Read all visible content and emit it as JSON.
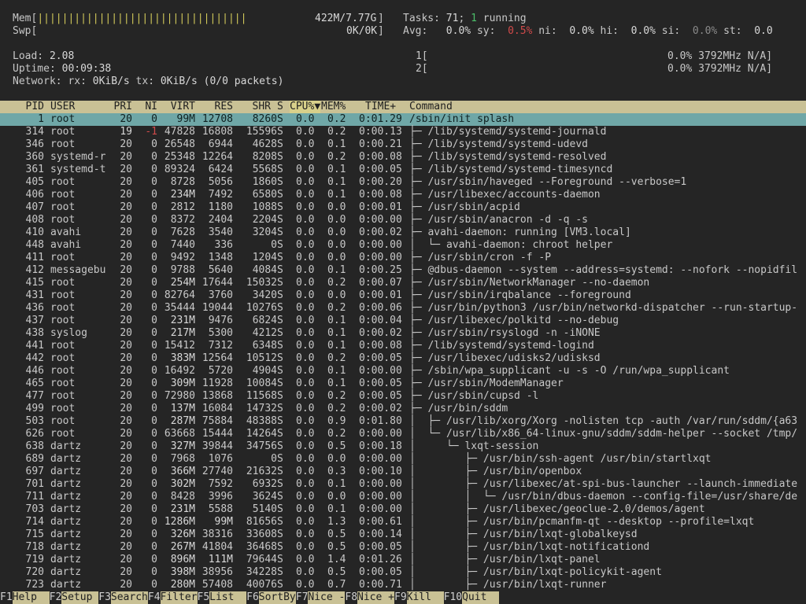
{
  "meters": {
    "mem": {
      "label": "Mem",
      "bar": "||||||||||||||||||||||||||||||||||",
      "value": "422M/7.77G"
    },
    "swp": {
      "label": "Swp",
      "bar": "",
      "value": "0K/0K"
    },
    "load": {
      "label": "Load:",
      "value": "2.08"
    },
    "uptime": {
      "label": "Uptime:",
      "value": "00:09:38"
    },
    "network": {
      "label": "Network: rx:",
      "rx": "0KiB/s",
      "tx_label": "tx:",
      "tx": "0KiB/s",
      "packets": "(0/0 packets)"
    },
    "tasks": {
      "label": "Tasks:",
      "count": "71",
      "running": "1",
      "running_label": "running"
    },
    "avg": {
      "label": "Avg:",
      "us": "0.0%",
      "sy_label": "sy:",
      "sy": "0.5%",
      "ni_label": "ni:",
      "ni": "0.0%",
      "hi_label": "hi:",
      "hi": "0.0%",
      "si_label": "si:",
      "si": "0.0%",
      "st_label": "st:",
      "st": "0.0"
    },
    "cpu1": {
      "label": "1[",
      "value": "0.0% 3792MHz N/A]"
    },
    "cpu2": {
      "label": "2[",
      "value": "0.0% 3792MHz N/A]"
    }
  },
  "columns": {
    "pid": "PID",
    "user": "USER",
    "pri": "PRI",
    "ni": "NI",
    "virt": "VIRT",
    "res": "RES",
    "shr": "SHR",
    "s": "S",
    "cpu": "CPU%",
    "sort_arrow": "▼",
    "mem": "MEM%",
    "time": "TIME+",
    "command": "Command"
  },
  "processes": [
    {
      "pid": "1",
      "user": "root",
      "pri": "20",
      "ni": "0",
      "virt": "99M",
      "res": "12708",
      "shr": "8260",
      "s": "S",
      "cpu": "0.0",
      "mem": "0.2",
      "time": "0:01.29",
      "tree": "",
      "command": "/sbin/init splash"
    },
    {
      "pid": "314",
      "user": "root",
      "pri": "19",
      "ni": "-1",
      "virt": "47828",
      "res": "16808",
      "shr": "15596",
      "s": "S",
      "cpu": "0.0",
      "mem": "0.2",
      "time": "0:00.13",
      "tree": "├─ ",
      "command": "/lib/systemd/systemd-journald"
    },
    {
      "pid": "346",
      "user": "root",
      "pri": "20",
      "ni": "0",
      "virt": "26548",
      "res": "6944",
      "shr": "4628",
      "s": "S",
      "cpu": "0.0",
      "mem": "0.1",
      "time": "0:00.21",
      "tree": "├─ ",
      "command": "/lib/systemd/systemd-udevd"
    },
    {
      "pid": "360",
      "user": "systemd-r",
      "pri": "20",
      "ni": "0",
      "virt": "25348",
      "res": "12264",
      "shr": "8208",
      "s": "S",
      "cpu": "0.0",
      "mem": "0.2",
      "time": "0:00.08",
      "tree": "├─ ",
      "command": "/lib/systemd/systemd-resolved"
    },
    {
      "pid": "361",
      "user": "systemd-t",
      "pri": "20",
      "ni": "0",
      "virt": "89324",
      "res": "6424",
      "shr": "5568",
      "s": "S",
      "cpu": "0.0",
      "mem": "0.1",
      "time": "0:00.05",
      "tree": "├─ ",
      "command": "/lib/systemd/systemd-timesyncd"
    },
    {
      "pid": "405",
      "user": "root",
      "pri": "20",
      "ni": "0",
      "virt": "8728",
      "res": "5056",
      "shr": "1860",
      "s": "S",
      "cpu": "0.0",
      "mem": "0.1",
      "time": "0:00.20",
      "tree": "├─ ",
      "command": "/usr/sbin/haveged --Foreground --verbose=1"
    },
    {
      "pid": "406",
      "user": "root",
      "pri": "20",
      "ni": "0",
      "virt": "234M",
      "res": "7492",
      "shr": "6580",
      "s": "S",
      "cpu": "0.0",
      "mem": "0.1",
      "time": "0:00.08",
      "tree": "├─ ",
      "command": "/usr/libexec/accounts-daemon"
    },
    {
      "pid": "407",
      "user": "root",
      "pri": "20",
      "ni": "0",
      "virt": "2812",
      "res": "1180",
      "shr": "1088",
      "s": "S",
      "cpu": "0.0",
      "mem": "0.0",
      "time": "0:00.01",
      "tree": "├─ ",
      "command": "/usr/sbin/acpid"
    },
    {
      "pid": "408",
      "user": "root",
      "pri": "20",
      "ni": "0",
      "virt": "8372",
      "res": "2404",
      "shr": "2204",
      "s": "S",
      "cpu": "0.0",
      "mem": "0.0",
      "time": "0:00.00",
      "tree": "├─ ",
      "command": "/usr/sbin/anacron -d -q -s"
    },
    {
      "pid": "410",
      "user": "avahi",
      "pri": "20",
      "ni": "0",
      "virt": "7628",
      "res": "3540",
      "shr": "3204",
      "s": "S",
      "cpu": "0.0",
      "mem": "0.0",
      "time": "0:00.02",
      "tree": "├─ ",
      "command": "avahi-daemon: running [VM3.local]"
    },
    {
      "pid": "448",
      "user": "avahi",
      "pri": "20",
      "ni": "0",
      "virt": "7440",
      "res": "336",
      "shr": "0",
      "s": "S",
      "cpu": "0.0",
      "mem": "0.0",
      "time": "0:00.00",
      "tree": "│  └─ ",
      "command": "avahi-daemon: chroot helper"
    },
    {
      "pid": "411",
      "user": "root",
      "pri": "20",
      "ni": "0",
      "virt": "9492",
      "res": "1348",
      "shr": "1204",
      "s": "S",
      "cpu": "0.0",
      "mem": "0.0",
      "time": "0:00.00",
      "tree": "├─ ",
      "command": "/usr/sbin/cron -f -P"
    },
    {
      "pid": "412",
      "user": "messagebu",
      "pri": "20",
      "ni": "0",
      "virt": "9788",
      "res": "5640",
      "shr": "4084",
      "s": "S",
      "cpu": "0.0",
      "mem": "0.1",
      "time": "0:00.25",
      "tree": "├─ ",
      "command": "@dbus-daemon --system --address=systemd: --nofork --nopidfil"
    },
    {
      "pid": "415",
      "user": "root",
      "pri": "20",
      "ni": "0",
      "virt": "254M",
      "res": "17644",
      "shr": "15032",
      "s": "S",
      "cpu": "0.0",
      "mem": "0.2",
      "time": "0:00.07",
      "tree": "├─ ",
      "command": "/usr/sbin/NetworkManager --no-daemon"
    },
    {
      "pid": "431",
      "user": "root",
      "pri": "20",
      "ni": "0",
      "virt": "82764",
      "res": "3760",
      "shr": "3420",
      "s": "S",
      "cpu": "0.0",
      "mem": "0.0",
      "time": "0:00.01",
      "tree": "├─ ",
      "command": "/usr/sbin/irqbalance --foreground"
    },
    {
      "pid": "436",
      "user": "root",
      "pri": "20",
      "ni": "0",
      "virt": "35444",
      "res": "19044",
      "shr": "10276",
      "s": "S",
      "cpu": "0.0",
      "mem": "0.2",
      "time": "0:00.06",
      "tree": "├─ ",
      "command": "/usr/bin/python3 /usr/bin/networkd-dispatcher --run-startup-"
    },
    {
      "pid": "437",
      "user": "root",
      "pri": "20",
      "ni": "0",
      "virt": "231M",
      "res": "9476",
      "shr": "6824",
      "s": "S",
      "cpu": "0.0",
      "mem": "0.1",
      "time": "0:00.04",
      "tree": "├─ ",
      "command": "/usr/libexec/polkitd --no-debug"
    },
    {
      "pid": "438",
      "user": "syslog",
      "pri": "20",
      "ni": "0",
      "virt": "217M",
      "res": "5300",
      "shr": "4212",
      "s": "S",
      "cpu": "0.0",
      "mem": "0.1",
      "time": "0:00.02",
      "tree": "├─ ",
      "command": "/usr/sbin/rsyslogd -n -iNONE"
    },
    {
      "pid": "441",
      "user": "root",
      "pri": "20",
      "ni": "0",
      "virt": "15412",
      "res": "7312",
      "shr": "6348",
      "s": "S",
      "cpu": "0.0",
      "mem": "0.1",
      "time": "0:00.08",
      "tree": "├─ ",
      "command": "/lib/systemd/systemd-logind"
    },
    {
      "pid": "442",
      "user": "root",
      "pri": "20",
      "ni": "0",
      "virt": "383M",
      "res": "12564",
      "shr": "10512",
      "s": "S",
      "cpu": "0.0",
      "mem": "0.2",
      "time": "0:00.05",
      "tree": "├─ ",
      "command": "/usr/libexec/udisks2/udisksd"
    },
    {
      "pid": "446",
      "user": "root",
      "pri": "20",
      "ni": "0",
      "virt": "16492",
      "res": "5720",
      "shr": "4904",
      "s": "S",
      "cpu": "0.0",
      "mem": "0.1",
      "time": "0:00.00",
      "tree": "├─ ",
      "command": "/sbin/wpa_supplicant -u -s -O /run/wpa_supplicant"
    },
    {
      "pid": "465",
      "user": "root",
      "pri": "20",
      "ni": "0",
      "virt": "309M",
      "res": "11928",
      "shr": "10084",
      "s": "S",
      "cpu": "0.0",
      "mem": "0.1",
      "time": "0:00.05",
      "tree": "├─ ",
      "command": "/usr/sbin/ModemManager"
    },
    {
      "pid": "477",
      "user": "root",
      "pri": "20",
      "ni": "0",
      "virt": "72980",
      "res": "13868",
      "shr": "11568",
      "s": "S",
      "cpu": "0.0",
      "mem": "0.2",
      "time": "0:00.05",
      "tree": "├─ ",
      "command": "/usr/sbin/cupsd -l"
    },
    {
      "pid": "499",
      "user": "root",
      "pri": "20",
      "ni": "0",
      "virt": "137M",
      "res": "16084",
      "shr": "14732",
      "s": "S",
      "cpu": "0.0",
      "mem": "0.2",
      "time": "0:00.02",
      "tree": "├─ ",
      "command": "/usr/bin/sddm"
    },
    {
      "pid": "503",
      "user": "root",
      "pri": "20",
      "ni": "0",
      "virt": "287M",
      "res": "75884",
      "shr": "48388",
      "s": "S",
      "cpu": "0.0",
      "mem": "0.9",
      "time": "0:01.80",
      "tree": "│  ├─ ",
      "command": "/usr/lib/xorg/Xorg -nolisten tcp -auth /var/run/sddm/{a63"
    },
    {
      "pid": "626",
      "user": "root",
      "pri": "20",
      "ni": "0",
      "virt": "63668",
      "res": "15444",
      "shr": "14264",
      "s": "S",
      "cpu": "0.0",
      "mem": "0.2",
      "time": "0:00.00",
      "tree": "│  └─ ",
      "command": "/usr/lib/x86_64-linux-gnu/sddm/sddm-helper --socket /tmp/"
    },
    {
      "pid": "638",
      "user": "dartz",
      "pri": "20",
      "ni": "0",
      "virt": "327M",
      "res": "39844",
      "shr": "34756",
      "s": "S",
      "cpu": "0.0",
      "mem": "0.5",
      "time": "0:00.18",
      "tree": "│     └─ ",
      "command": "lxqt-session"
    },
    {
      "pid": "689",
      "user": "dartz",
      "pri": "20",
      "ni": "0",
      "virt": "7968",
      "res": "1076",
      "shr": "0",
      "s": "S",
      "cpu": "0.0",
      "mem": "0.0",
      "time": "0:00.00",
      "tree": "│        ├─ ",
      "command": "/usr/bin/ssh-agent /usr/bin/startlxqt"
    },
    {
      "pid": "697",
      "user": "dartz",
      "pri": "20",
      "ni": "0",
      "virt": "366M",
      "res": "27740",
      "shr": "21632",
      "s": "S",
      "cpu": "0.0",
      "mem": "0.3",
      "time": "0:00.10",
      "tree": "│        ├─ ",
      "command": "/usr/bin/openbox"
    },
    {
      "pid": "701",
      "user": "dartz",
      "pri": "20",
      "ni": "0",
      "virt": "302M",
      "res": "7592",
      "shr": "6932",
      "s": "S",
      "cpu": "0.0",
      "mem": "0.1",
      "time": "0:00.00",
      "tree": "│        ├─ ",
      "command": "/usr/libexec/at-spi-bus-launcher --launch-immediate"
    },
    {
      "pid": "711",
      "user": "dartz",
      "pri": "20",
      "ni": "0",
      "virt": "8428",
      "res": "3996",
      "shr": "3624",
      "s": "S",
      "cpu": "0.0",
      "mem": "0.0",
      "time": "0:00.00",
      "tree": "│        │  └─ ",
      "command": "/usr/bin/dbus-daemon --config-file=/usr/share/de"
    },
    {
      "pid": "703",
      "user": "dartz",
      "pri": "20",
      "ni": "0",
      "virt": "231M",
      "res": "5588",
      "shr": "5140",
      "s": "S",
      "cpu": "0.0",
      "mem": "0.1",
      "time": "0:00.00",
      "tree": "│        ├─ ",
      "command": "/usr/libexec/geoclue-2.0/demos/agent"
    },
    {
      "pid": "714",
      "user": "dartz",
      "pri": "20",
      "ni": "0",
      "virt": "1286M",
      "res": "99M",
      "shr": "81656",
      "s": "S",
      "cpu": "0.0",
      "mem": "1.3",
      "time": "0:00.61",
      "tree": "│        ├─ ",
      "command": "/usr/bin/pcmanfm-qt --desktop --profile=lxqt"
    },
    {
      "pid": "715",
      "user": "dartz",
      "pri": "20",
      "ni": "0",
      "virt": "326M",
      "res": "38316",
      "shr": "33608",
      "s": "S",
      "cpu": "0.0",
      "mem": "0.5",
      "time": "0:00.14",
      "tree": "│        ├─ ",
      "command": "/usr/bin/lxqt-globalkeysd"
    },
    {
      "pid": "718",
      "user": "dartz",
      "pri": "20",
      "ni": "0",
      "virt": "267M",
      "res": "41804",
      "shr": "36468",
      "s": "S",
      "cpu": "0.0",
      "mem": "0.5",
      "time": "0:00.05",
      "tree": "│        ├─ ",
      "command": "/usr/bin/lxqt-notificationd"
    },
    {
      "pid": "719",
      "user": "dartz",
      "pri": "20",
      "ni": "0",
      "virt": "896M",
      "res": "111M",
      "shr": "79644",
      "s": "S",
      "cpu": "0.0",
      "mem": "1.4",
      "time": "0:01.26",
      "tree": "│        ├─ ",
      "command": "/usr/bin/lxqt-panel"
    },
    {
      "pid": "720",
      "user": "dartz",
      "pri": "20",
      "ni": "0",
      "virt": "398M",
      "res": "38956",
      "shr": "34228",
      "s": "S",
      "cpu": "0.0",
      "mem": "0.5",
      "time": "0:00.05",
      "tree": "│        ├─ ",
      "command": "/usr/bin/lxqt-policykit-agent"
    },
    {
      "pid": "723",
      "user": "dartz",
      "pri": "20",
      "ni": "0",
      "virt": "280M",
      "res": "57408",
      "shr": "40076",
      "s": "S",
      "cpu": "0.0",
      "mem": "0.7",
      "time": "0:00.71",
      "tree": "│        ├─ ",
      "command": "/usr/bin/lxqt-runner"
    }
  ],
  "footer": [
    {
      "key": "F1",
      "label": "Help  "
    },
    {
      "key": "F2",
      "label": "Setup "
    },
    {
      "key": "F3",
      "label": "Search"
    },
    {
      "key": "F4",
      "label": "Filter"
    },
    {
      "key": "F5",
      "label": "List  "
    },
    {
      "key": "F6",
      "label": "SortBy"
    },
    {
      "key": "F7",
      "label": "Nice -"
    },
    {
      "key": "F8",
      "label": "Nice +"
    },
    {
      "key": "F9",
      "label": "Kill  "
    },
    {
      "key": "F10",
      "label": "Quit  "
    }
  ]
}
